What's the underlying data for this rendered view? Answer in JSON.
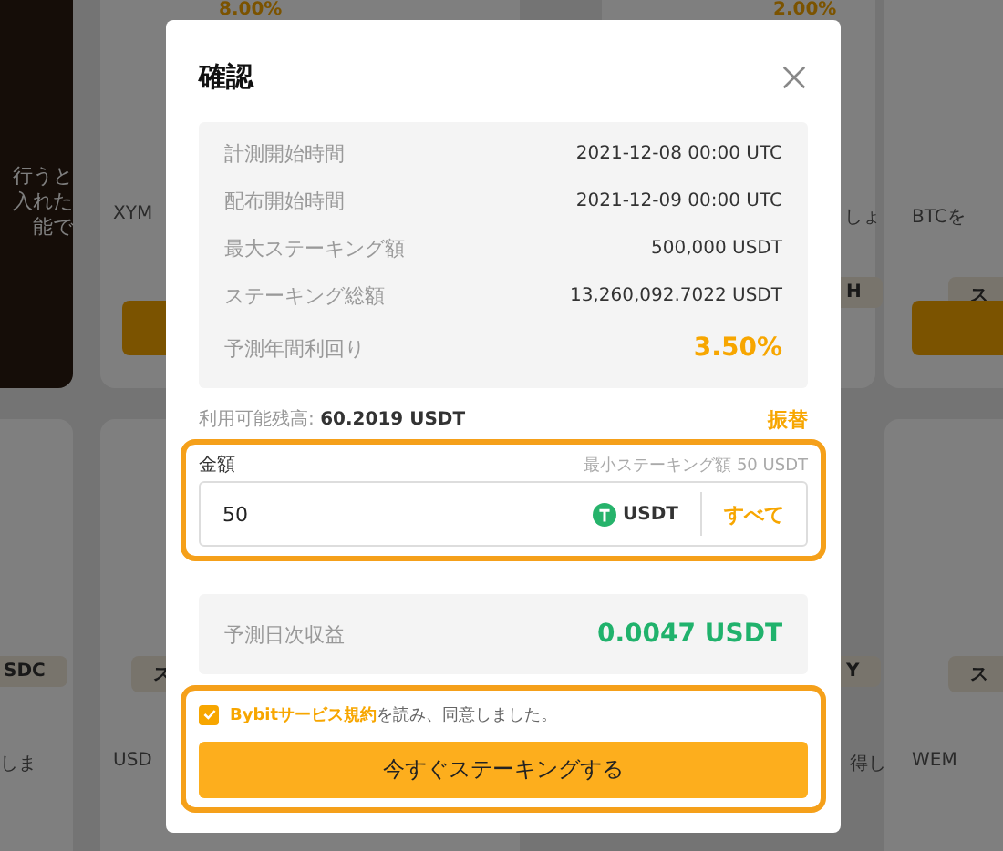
{
  "background": {
    "percents": [
      "8.00%",
      "2.00%"
    ],
    "promo_lines": [
      "行うと",
      "入れた",
      "能で"
    ],
    "card_texts": [
      "XYM",
      "しょ",
      "BTCを",
      "しま",
      "USD",
      "得し",
      "WEM"
    ],
    "tags": [
      "H",
      "ス",
      "SDC",
      "ス",
      "Y",
      "ス"
    ]
  },
  "dialog": {
    "title": "確認",
    "info_rows": [
      {
        "label": "計測開始時間",
        "value": "2021-12-08 00:00 UTC",
        "kind": "plain"
      },
      {
        "label": "配布開始時間",
        "value": "2021-12-09 00:00 UTC",
        "kind": "plain"
      },
      {
        "label": "最大ステーキング額",
        "value": "500,000 USDT",
        "kind": "plain"
      },
      {
        "label": "ステーキング総額",
        "value": "13,260,092.7022 USDT",
        "kind": "plain"
      },
      {
        "label": "予測年間利回り",
        "value": "3.50%",
        "kind": "highlight"
      }
    ],
    "balance": {
      "label": "利用可能残高:",
      "value": "60.2019 USDT",
      "link": "振替"
    },
    "amount": {
      "label": "金額",
      "minimum": "最小ステーキング額 50 USDT",
      "value": "50",
      "currency": "USDT",
      "all_button": "すべて"
    },
    "estimate": {
      "label": "予測日次収益",
      "value": "0.0047 USDT"
    },
    "agreement": {
      "checked": true,
      "link": "Bybitサービス規約",
      "text": "を読み、同意しました。"
    },
    "submit": "今すぐステーキングする"
  }
}
